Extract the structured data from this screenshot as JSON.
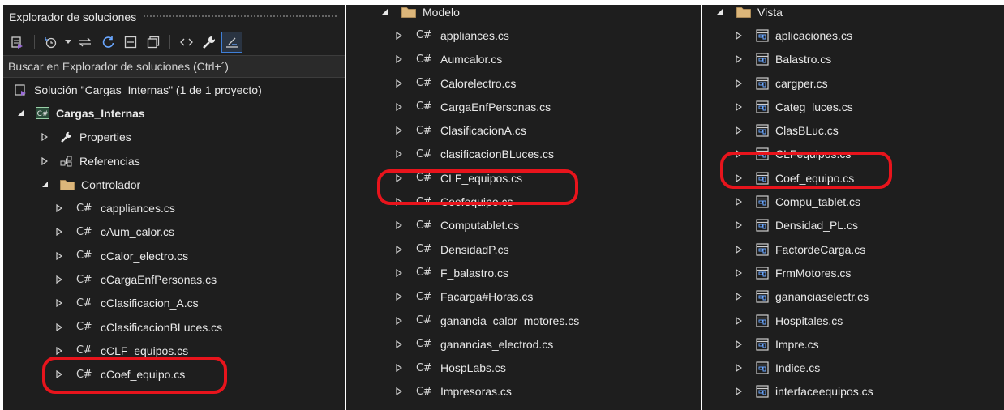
{
  "window": {
    "title": "Explorador de soluciones"
  },
  "toolbar": {
    "icons": [
      "vs-solution-icon",
      "history-icon",
      "chevron-down-icon",
      "sync-arrows-icon",
      "refresh-icon",
      "collapse-all-icon",
      "copy-icon",
      "code-view-icon",
      "wrench-icon",
      "preview-icon"
    ]
  },
  "search": {
    "placeholder": "Buscar en Explorador de soluciones (Ctrl+´)"
  },
  "panel1": {
    "solution": {
      "label": "Solución \"Cargas_Internas\"  (1 de 1 proyecto)"
    },
    "project": {
      "label": "Cargas_Internas",
      "icon": "csharp-project-icon"
    },
    "properties": {
      "label": "Properties",
      "icon": "wrench-icon"
    },
    "references": {
      "label": "Referencias",
      "icon": "references-icon"
    },
    "folder": {
      "label": "Controlador",
      "icon": "folder-icon"
    },
    "files": [
      {
        "label": "cappliances.cs"
      },
      {
        "label": "cAum_calor.cs"
      },
      {
        "label": "cCalor_electro.cs"
      },
      {
        "label": "cCargaEnfPersonas.cs"
      },
      {
        "label": "cClasificacion_A.cs"
      },
      {
        "label": "cClasificacionBLuces.cs"
      },
      {
        "label": "cCLF_equipos.cs"
      },
      {
        "label": "cCoef_equipo.cs"
      }
    ]
  },
  "panel2": {
    "folder": {
      "label": "Modelo",
      "icon": "folder-icon"
    },
    "files": [
      {
        "label": "appliances.cs"
      },
      {
        "label": "Aumcalor.cs"
      },
      {
        "label": "Calorelectro.cs"
      },
      {
        "label": "CargaEnfPersonas.cs"
      },
      {
        "label": "ClasificacionA.cs"
      },
      {
        "label": "clasificacionBLuces.cs"
      },
      {
        "label": "CLF_equipos.cs"
      },
      {
        "label": "Coefequipo.cs"
      },
      {
        "label": "Computablet.cs"
      },
      {
        "label": "DensidadP.cs"
      },
      {
        "label": "F_balastro.cs"
      },
      {
        "label": "Facarga#Horas.cs"
      },
      {
        "label": "ganancia_calor_motores.cs"
      },
      {
        "label": "ganancias_electrod.cs"
      },
      {
        "label": "HospLabs.cs"
      },
      {
        "label": "Impresoras.cs"
      }
    ]
  },
  "panel3": {
    "folder": {
      "label": "Vista",
      "icon": "folder-icon"
    },
    "files": [
      {
        "label": "aplicaciones.cs"
      },
      {
        "label": "Balastro.cs"
      },
      {
        "label": "cargper.cs"
      },
      {
        "label": "Categ_luces.cs"
      },
      {
        "label": "ClasBLuc.cs"
      },
      {
        "label": "CLFequipos.cs"
      },
      {
        "label": "Coef_equipo.cs"
      },
      {
        "label": "Compu_tablet.cs"
      },
      {
        "label": "Densidad_PL.cs"
      },
      {
        "label": "FactordeCarga.cs"
      },
      {
        "label": "FrmMotores.cs"
      },
      {
        "label": "gananciaselectr.cs"
      },
      {
        "label": "Hospitales.cs"
      },
      {
        "label": "Impre.cs"
      },
      {
        "label": "Indice.cs"
      },
      {
        "label": "interfaceequipos.cs"
      }
    ]
  },
  "glyphs": {
    "csharp": "C#"
  },
  "colors": {
    "background": "#1e1e1e",
    "folder": "#dcb67a",
    "highlight": "#e8141c",
    "accent": "#3f7fd8"
  }
}
